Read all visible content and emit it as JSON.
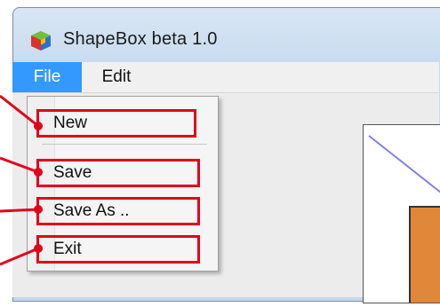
{
  "window": {
    "title": "ShapeBox beta 1.0"
  },
  "menubar": {
    "items": [
      {
        "label": "File",
        "active": true
      },
      {
        "label": "Edit",
        "active": false
      }
    ]
  },
  "file_menu": {
    "items": [
      {
        "label": "New"
      },
      {
        "label": "Save"
      },
      {
        "label": "Save As .."
      },
      {
        "label": "Exit"
      }
    ]
  },
  "colors": {
    "menu_highlight": "#3399ff",
    "annotation_red": "#e4001b",
    "canvas_shape_fill": "#e0873a",
    "diagonal_line": "#8080e0"
  },
  "icons": {
    "app": "cube-logo-icon"
  }
}
